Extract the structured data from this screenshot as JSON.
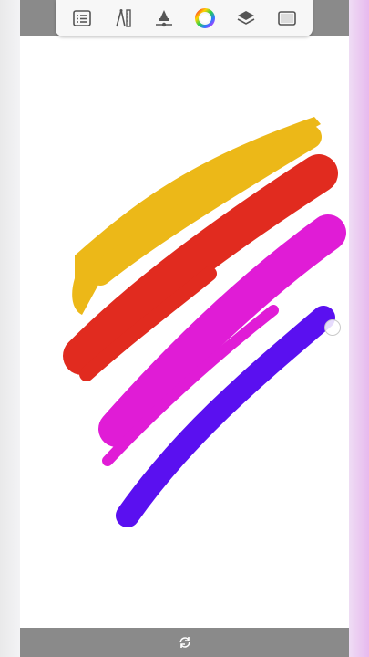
{
  "app": {
    "name": ""
  },
  "toolbar": {
    "tools": [
      {
        "id": "menu",
        "icon": "list-icon"
      },
      {
        "id": "ruler",
        "icon": "ruler-compass-icon"
      },
      {
        "id": "brush",
        "icon": "brush-tool-icon"
      },
      {
        "id": "color",
        "icon": "color-wheel-icon"
      },
      {
        "id": "layers",
        "icon": "layers-icon"
      },
      {
        "id": "canvas",
        "icon": "canvas-icon"
      }
    ]
  },
  "strokes": [
    {
      "name": "yellow-stroke",
      "color": "#ECB818"
    },
    {
      "name": "red-stroke",
      "color": "#E12B1F"
    },
    {
      "name": "magenta-stroke",
      "color": "#E01CD6"
    },
    {
      "name": "violet-stroke",
      "color": "#5A10F0"
    }
  ],
  "bottombar": {
    "icon": "sync-icon"
  }
}
